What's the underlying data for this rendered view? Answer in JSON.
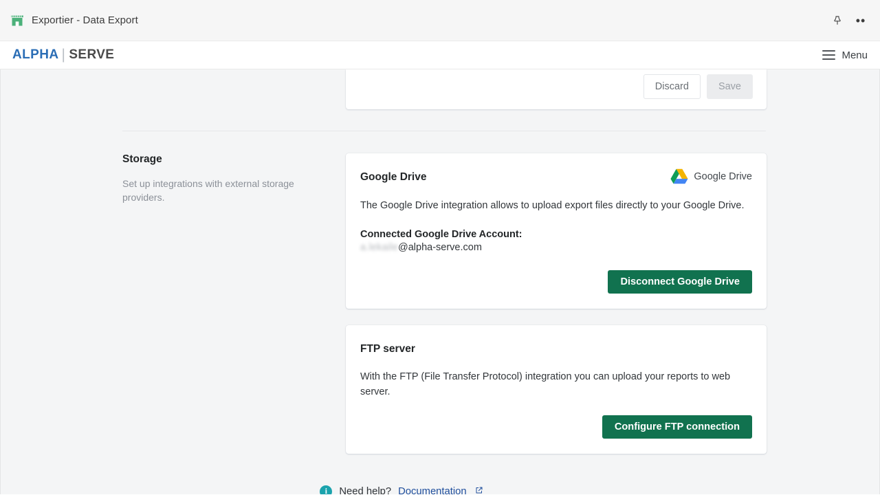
{
  "titlebar": {
    "app_title": "Exportier - Data Export",
    "favicon_name": "store-icon",
    "pin_icon": "pin-icon",
    "more_icon": "ellipsis-icon",
    "more_glyph": "••"
  },
  "appbar": {
    "brand_first": "ALPHA",
    "brand_separator": "|",
    "brand_second": "SERVE",
    "menu_label": "Menu",
    "menu_icon": "hamburger-icon"
  },
  "top_card": {
    "discard_label": "Discard",
    "save_label": "Save",
    "save_disabled": true
  },
  "storage": {
    "title": "Storage",
    "description": "Set up integrations with external storage providers."
  },
  "google_drive": {
    "title": "Google Drive",
    "logo_icon": "google-drive-icon",
    "logo_text": "Google Drive",
    "description": "The Google Drive integration allows to upload export files directly to your Google Drive.",
    "account_label": "Connected Google Drive Account:",
    "account_redacted": "a.lekaile",
    "account_domain": "@alpha-serve.com",
    "disconnect_label": "Disconnect Google Drive"
  },
  "ftp": {
    "title": "FTP server",
    "description": "With the FTP (File Transfer Protocol) integration you can upload your reports to web server.",
    "configure_label": "Configure FTP connection"
  },
  "help": {
    "info_icon": "info-icon",
    "info_glyph": "i",
    "text": "Need help?",
    "link_label": "Documentation",
    "external_icon": "external-link-icon"
  },
  "colors": {
    "brand_blue": "#2a6db5",
    "brand_gray": "#4a4a4a",
    "primary_green": "#11724f",
    "info_teal": "#1ba3ad",
    "link_blue": "#1f4e9c",
    "page_bg": "#f4f5f6"
  }
}
